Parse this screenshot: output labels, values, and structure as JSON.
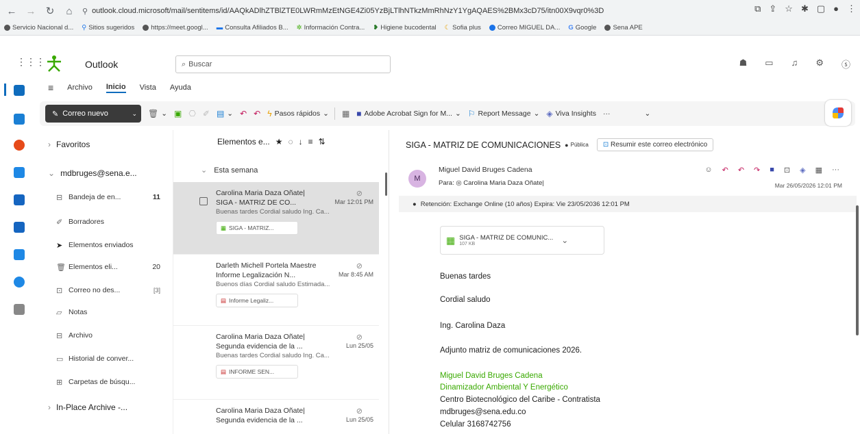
{
  "browser": {
    "url": "outlook.cloud.microsoft/mail/sentitems/id/AAQkADlhZTBlZTE0LWRmMzEtNGE4Zi05YzBjLTlhNTkzMmRhNzY1YgAQAES%2BMx3cD75/itn00X9vqr0%3D",
    "bookmarks": [
      "Servicio Nacional d...",
      "Sitios sugeridos",
      "https://meet.googl...",
      "Consulta Afiliados B...",
      "Información Contra...",
      "Higiene bucodental",
      "Sofia plus",
      "Correo MIGUEL DA...",
      "Google",
      "Sena APE"
    ]
  },
  "header": {
    "app_name": "Outlook",
    "search_placeholder": "Buscar"
  },
  "menu": [
    "Archivo",
    "Inicio",
    "Vista",
    "Ayuda"
  ],
  "ribbon": {
    "new_mail": "Correo nuevo",
    "quick_steps": "Pasos rápidos",
    "adobe": "Adobe Acrobat Sign for M...",
    "report": "Report Message",
    "viva": "Viva Insights",
    "more": "···"
  },
  "folders": {
    "favorites": "Favoritos",
    "account": "mdbruges@sena.e...",
    "items": [
      {
        "label": "Bandeja de en...",
        "count": "11"
      },
      {
        "label": "Borradores",
        "count": ""
      },
      {
        "label": "Elementos enviados",
        "count": ""
      },
      {
        "label": "Elementos eli...",
        "count": "20"
      },
      {
        "label": "Correo no des...",
        "count": "[3]"
      },
      {
        "label": "Notas",
        "count": ""
      },
      {
        "label": "Archivo",
        "count": ""
      },
      {
        "label": "Historial de conver...",
        "count": ""
      },
      {
        "label": "Carpetas de búsqu...",
        "count": ""
      }
    ],
    "archive": "In-Place Archive -..."
  },
  "list": {
    "title": "Elementos e...",
    "week": "Esta semana",
    "mails": [
      {
        "from": "Carolina Maria Daza Oñate|",
        "subject": "SIGA - MATRIZ DE CO...",
        "date": "Mar 12:01 PM",
        "preview": "Buenas tardes Cordial saludo Ing. Ca...",
        "attachment": "SIGA - MATRIZ..."
      },
      {
        "from": "Darleth Michell Portela Maestre",
        "subject": "Informe Legalización N...",
        "date": "Mar 8:45 AM",
        "preview": "Buenos días Cordial saludo Estimada...",
        "attachment": "Informe Legaliz..."
      },
      {
        "from": "Carolina Maria Daza Oñate|",
        "subject": "Segunda evidencia de la ...",
        "date": "Lun 25/05",
        "preview": "Buenas tardes Cordial saludo Ing. Ca...",
        "attachment": "INFORME SEN..."
      },
      {
        "from": "Carolina Maria Daza Oñate|",
        "subject": "Segunda evidencia de la ...",
        "date": "Lun 25/05",
        "preview": "",
        "attachment": ""
      }
    ]
  },
  "reading": {
    "subject": "SIGA - MATRIZ DE COMUNICACIONES",
    "public": "Pública",
    "summarize": "Resumir este correo electrónico",
    "avatar": "M",
    "sender": "Miguel David Bruges Cadena",
    "to": "Para: ◎ Carolina Maria Daza Oñate|",
    "date": "Mar 26/05/2026 12:01 PM",
    "retention": "Retención: Exchange Online (10 años) Expira: Vie 23/05/2036 12:01 PM",
    "attachment_name": "SIGA - MATRIZ DE COMUNIC...",
    "attachment_size": "107 KB",
    "body": [
      "Buenas tardes",
      "Cordial saludo",
      "Ing. Carolina Daza",
      "Adjunto matriz de comunicaciones 2026."
    ],
    "signature_name": "Miguel David Bruges Cadena",
    "signature_role": "Dinamizador Ambiental Y Energético",
    "signature_lines": [
      "Centro Biotecnológico del Caribe - Contratista",
      "mdbruges@sena.edu.co",
      "Celular 3168742756"
    ]
  },
  "colors": {
    "sena_green": "#39a900",
    "dark_button": "#3a3a3a",
    "selected_row": "#e0e0e0"
  }
}
